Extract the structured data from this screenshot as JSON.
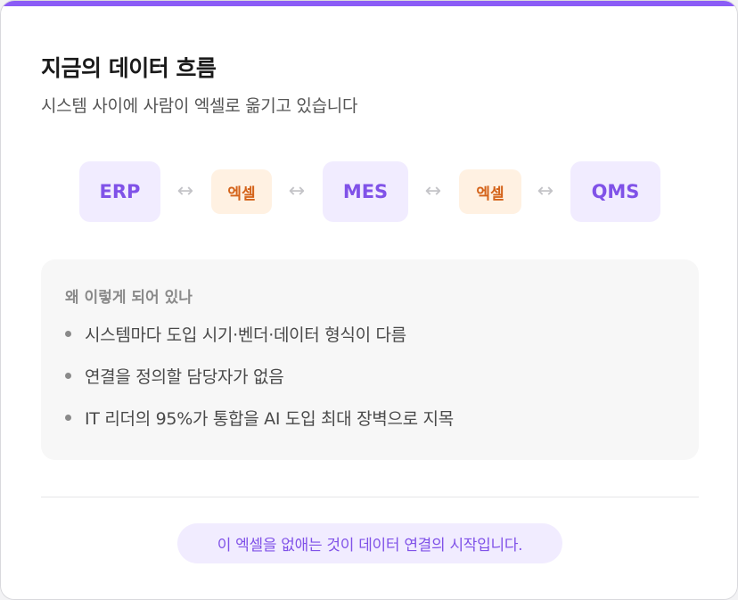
{
  "card": {
    "title": "지금의 데이터 흐름",
    "subtitle": "시스템 사이에 사람이 엑셀로 옮기고 있습니다"
  },
  "flow": {
    "nodes": [
      "ERP",
      "MES",
      "QMS"
    ],
    "bridges": [
      "엑셀",
      "엑셀"
    ],
    "arrow_glyph": "↔"
  },
  "reasons": {
    "title": "왜 이렇게 되어 있나",
    "items": [
      "시스템마다 도입 시기·벤더·데이터 형식이 다름",
      "연결을 정의할 담당자가 없음",
      "IT 리더의 95%가 통합을 AI 도입 최대 장벽으로 지목"
    ]
  },
  "cta": {
    "label": "이 엑셀을 없애는 것이 데이터 연결의 시작입니다."
  },
  "colors": {
    "accent": "#8b5cf6",
    "node_bg": "#f1ecff",
    "node_text": "#8052e8",
    "excel_bg": "#fff1e2",
    "excel_text": "#d4631a"
  }
}
